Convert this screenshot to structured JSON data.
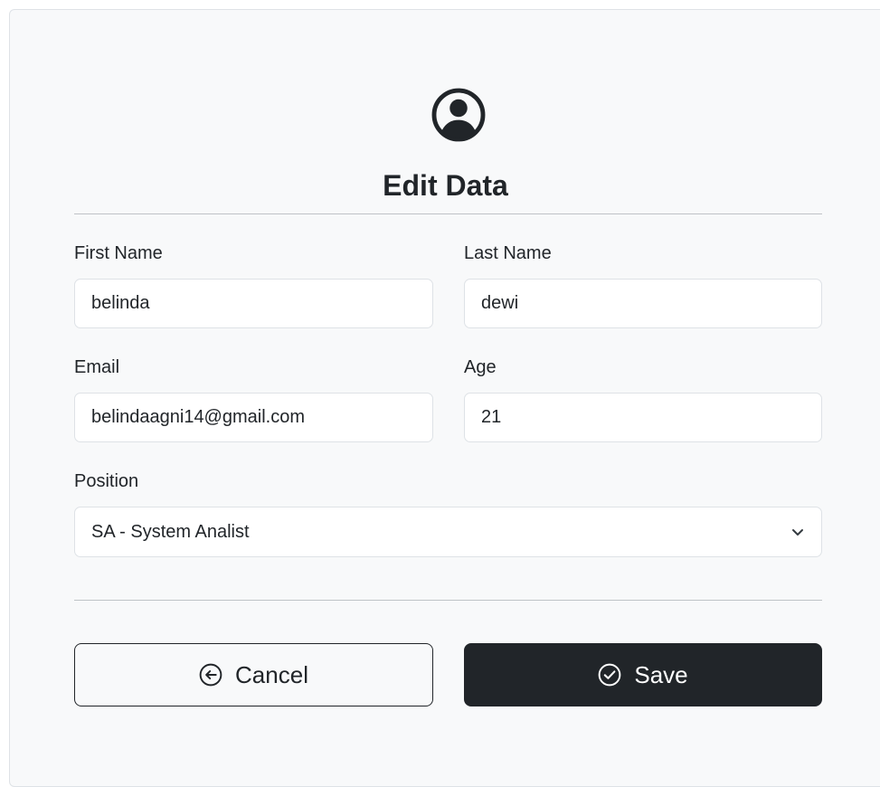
{
  "form": {
    "title": "Edit Data",
    "avatar_icon": "person-circle-icon",
    "fields": {
      "first_name": {
        "label": "First Name",
        "value": "belinda"
      },
      "last_name": {
        "label": "Last Name",
        "value": "dewi"
      },
      "email": {
        "label": "Email",
        "value": "belindaagni14@gmail.com"
      },
      "age": {
        "label": "Age",
        "value": "21"
      },
      "position": {
        "label": "Position",
        "selected": "SA - System Analist"
      }
    },
    "buttons": {
      "cancel": {
        "label": "Cancel",
        "icon": "arrow-left-circle-icon"
      },
      "save": {
        "label": "Save",
        "icon": "check-circle-icon"
      }
    },
    "colors": {
      "background": "#f8f9fa",
      "dark": "#212529"
    }
  }
}
